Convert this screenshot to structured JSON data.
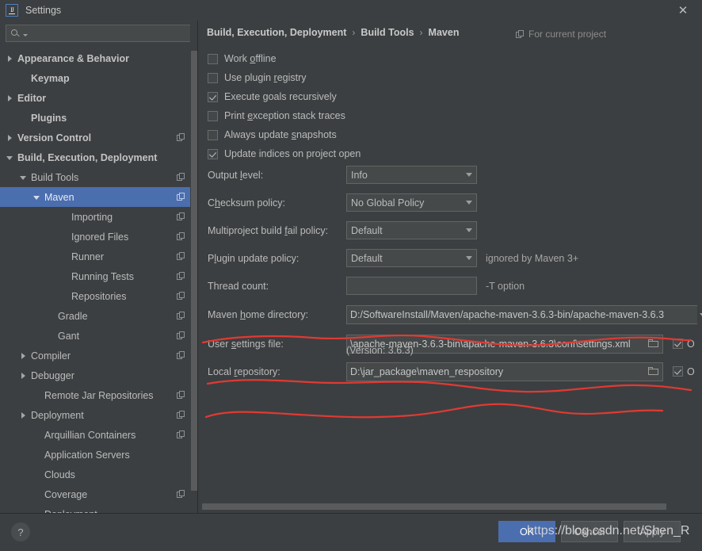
{
  "window": {
    "title": "Settings",
    "logo_text": "IJ",
    "close_icon": "✕"
  },
  "sidebar": {
    "search": {
      "value": "",
      "placeholder": ""
    },
    "items": [
      {
        "label": "Appearance & Behavior",
        "indent": 0,
        "arrow": "right",
        "bold": true,
        "project": false,
        "selected": false
      },
      {
        "label": "Keymap",
        "indent": 1,
        "arrow": "none",
        "bold": true,
        "project": false,
        "selected": false
      },
      {
        "label": "Editor",
        "indent": 0,
        "arrow": "right",
        "bold": true,
        "project": false,
        "selected": false
      },
      {
        "label": "Plugins",
        "indent": 1,
        "arrow": "none",
        "bold": true,
        "project": false,
        "selected": false
      },
      {
        "label": "Version Control",
        "indent": 0,
        "arrow": "right",
        "bold": true,
        "project": true,
        "selected": false
      },
      {
        "label": "Build, Execution, Deployment",
        "indent": 0,
        "arrow": "down",
        "bold": true,
        "project": false,
        "selected": false
      },
      {
        "label": "Build Tools",
        "indent": 1,
        "arrow": "down",
        "bold": false,
        "project": true,
        "selected": false
      },
      {
        "label": "Maven",
        "indent": 2,
        "arrow": "down",
        "bold": false,
        "project": true,
        "selected": true
      },
      {
        "label": "Importing",
        "indent": 4,
        "arrow": "none",
        "bold": false,
        "project": true,
        "selected": false
      },
      {
        "label": "Ignored Files",
        "indent": 4,
        "arrow": "none",
        "bold": false,
        "project": true,
        "selected": false
      },
      {
        "label": "Runner",
        "indent": 4,
        "arrow": "none",
        "bold": false,
        "project": true,
        "selected": false
      },
      {
        "label": "Running Tests",
        "indent": 4,
        "arrow": "none",
        "bold": false,
        "project": true,
        "selected": false
      },
      {
        "label": "Repositories",
        "indent": 4,
        "arrow": "none",
        "bold": false,
        "project": true,
        "selected": false
      },
      {
        "label": "Gradle",
        "indent": 3,
        "arrow": "none",
        "bold": false,
        "project": true,
        "selected": false
      },
      {
        "label": "Gant",
        "indent": 3,
        "arrow": "none",
        "bold": false,
        "project": true,
        "selected": false
      },
      {
        "label": "Compiler",
        "indent": 1,
        "arrow": "right",
        "bold": false,
        "project": true,
        "selected": false
      },
      {
        "label": "Debugger",
        "indent": 1,
        "arrow": "right",
        "bold": false,
        "project": false,
        "selected": false
      },
      {
        "label": "Remote Jar Repositories",
        "indent": 2,
        "arrow": "none",
        "bold": false,
        "project": true,
        "selected": false
      },
      {
        "label": "Deployment",
        "indent": 1,
        "arrow": "right",
        "bold": false,
        "project": true,
        "selected": false
      },
      {
        "label": "Arquillian Containers",
        "indent": 2,
        "arrow": "none",
        "bold": false,
        "project": true,
        "selected": false
      },
      {
        "label": "Application Servers",
        "indent": 2,
        "arrow": "none",
        "bold": false,
        "project": false,
        "selected": false
      },
      {
        "label": "Clouds",
        "indent": 2,
        "arrow": "none",
        "bold": false,
        "project": false,
        "selected": false
      },
      {
        "label": "Coverage",
        "indent": 2,
        "arrow": "none",
        "bold": false,
        "project": true,
        "selected": false
      },
      {
        "label": "Deployment",
        "indent": 2,
        "arrow": "none",
        "bold": false,
        "project": false,
        "selected": false
      }
    ]
  },
  "main": {
    "breadcrumb": {
      "part1": "Build, Execution, Deployment",
      "part2": "Build Tools",
      "part3": "Maven",
      "separator": "›"
    },
    "for_current_project": "For current project",
    "checkboxes": [
      {
        "label_pre": "Work ",
        "label_key": "o",
        "label_post": "ffline",
        "checked": false
      },
      {
        "label_pre": "Use plugin ",
        "label_key": "r",
        "label_post": "egistry",
        "checked": false
      },
      {
        "label_pre": "Execute ",
        "label_key": "g",
        "label_post": "oals recursively",
        "checked": true
      },
      {
        "label_pre": "Print ",
        "label_key": "e",
        "label_post": "xception stack traces",
        "checked": false
      },
      {
        "label_pre": "Always update ",
        "label_key": "s",
        "label_post": "napshots",
        "checked": false
      },
      {
        "label_pre": "Update indices on project open",
        "label_key": "",
        "label_post": "",
        "checked": true
      }
    ],
    "fields": {
      "output_level": {
        "label_pre": "Output ",
        "label_key": "l",
        "label_post": "evel:",
        "value": "Info"
      },
      "checksum_policy": {
        "label_pre": "C",
        "label_key": "h",
        "label_post": "ecksum policy:",
        "value": "No Global Policy"
      },
      "multiproject_fail_policy": {
        "label_pre": "Multiproject build ",
        "label_key": "f",
        "label_post": "ail policy:",
        "value": "Default"
      },
      "plugin_update_policy": {
        "label_pre": "P",
        "label_key": "l",
        "label_post": "ugin update policy:",
        "value": "Default",
        "hint": "ignored by Maven 3+"
      },
      "thread_count": {
        "label_pre": "Thread count:",
        "label_key": "",
        "label_post": "",
        "value": "",
        "hint": "-T option"
      },
      "maven_home": {
        "label_pre": "Maven ",
        "label_key": "h",
        "label_post": "ome directory:",
        "value": "D:/SoftwareInstall/Maven/apache-maven-3.6.3-bin/apache-maven-3.6.3",
        "version_note": "(Version: 3.6.3)"
      },
      "user_settings_file": {
        "label_pre": "User ",
        "label_key": "s",
        "label_post": "ettings file:",
        "value": "\\apache-maven-3.6.3-bin\\apache-maven-3.6.3\\conf\\settings.xml",
        "override_label": "O",
        "override_checked": true
      },
      "local_repository": {
        "label_pre": "Local ",
        "label_key": "r",
        "label_post": "epository:",
        "value": "D:\\jar_package\\maven_respository",
        "override_label": "O",
        "override_checked": true
      }
    }
  },
  "footer": {
    "help_label": "?",
    "ok_label": "OK",
    "cancel_label": "Cancel",
    "apply_label": "Apply"
  },
  "overlay": {
    "watermark": "https://blog.csdn.net/Shen_R",
    "annotation_color": "#e03a33"
  }
}
